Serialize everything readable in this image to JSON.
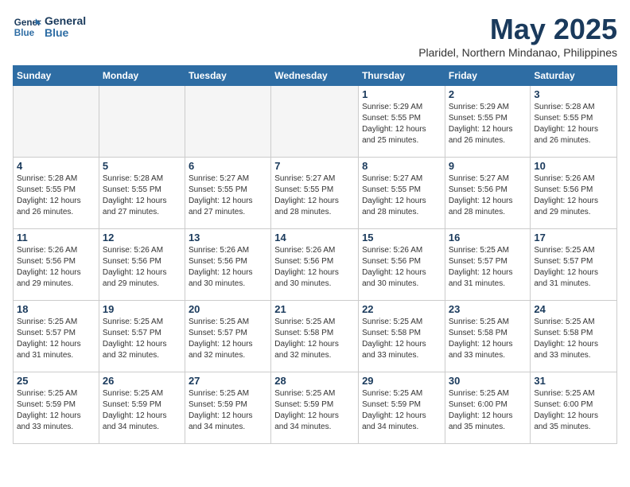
{
  "header": {
    "logo_line1": "General",
    "logo_line2": "Blue",
    "month": "May 2025",
    "location": "Plaridel, Northern Mindanao, Philippines"
  },
  "weekdays": [
    "Sunday",
    "Monday",
    "Tuesday",
    "Wednesday",
    "Thursday",
    "Friday",
    "Saturday"
  ],
  "weeks": [
    [
      {
        "day": "",
        "info": ""
      },
      {
        "day": "",
        "info": ""
      },
      {
        "day": "",
        "info": ""
      },
      {
        "day": "",
        "info": ""
      },
      {
        "day": "1",
        "info": "Sunrise: 5:29 AM\nSunset: 5:55 PM\nDaylight: 12 hours\nand 25 minutes."
      },
      {
        "day": "2",
        "info": "Sunrise: 5:29 AM\nSunset: 5:55 PM\nDaylight: 12 hours\nand 26 minutes."
      },
      {
        "day": "3",
        "info": "Sunrise: 5:28 AM\nSunset: 5:55 PM\nDaylight: 12 hours\nand 26 minutes."
      }
    ],
    [
      {
        "day": "4",
        "info": "Sunrise: 5:28 AM\nSunset: 5:55 PM\nDaylight: 12 hours\nand 26 minutes."
      },
      {
        "day": "5",
        "info": "Sunrise: 5:28 AM\nSunset: 5:55 PM\nDaylight: 12 hours\nand 27 minutes."
      },
      {
        "day": "6",
        "info": "Sunrise: 5:27 AM\nSunset: 5:55 PM\nDaylight: 12 hours\nand 27 minutes."
      },
      {
        "day": "7",
        "info": "Sunrise: 5:27 AM\nSunset: 5:55 PM\nDaylight: 12 hours\nand 28 minutes."
      },
      {
        "day": "8",
        "info": "Sunrise: 5:27 AM\nSunset: 5:55 PM\nDaylight: 12 hours\nand 28 minutes."
      },
      {
        "day": "9",
        "info": "Sunrise: 5:27 AM\nSunset: 5:56 PM\nDaylight: 12 hours\nand 28 minutes."
      },
      {
        "day": "10",
        "info": "Sunrise: 5:26 AM\nSunset: 5:56 PM\nDaylight: 12 hours\nand 29 minutes."
      }
    ],
    [
      {
        "day": "11",
        "info": "Sunrise: 5:26 AM\nSunset: 5:56 PM\nDaylight: 12 hours\nand 29 minutes."
      },
      {
        "day": "12",
        "info": "Sunrise: 5:26 AM\nSunset: 5:56 PM\nDaylight: 12 hours\nand 29 minutes."
      },
      {
        "day": "13",
        "info": "Sunrise: 5:26 AM\nSunset: 5:56 PM\nDaylight: 12 hours\nand 30 minutes."
      },
      {
        "day": "14",
        "info": "Sunrise: 5:26 AM\nSunset: 5:56 PM\nDaylight: 12 hours\nand 30 minutes."
      },
      {
        "day": "15",
        "info": "Sunrise: 5:26 AM\nSunset: 5:56 PM\nDaylight: 12 hours\nand 30 minutes."
      },
      {
        "day": "16",
        "info": "Sunrise: 5:25 AM\nSunset: 5:57 PM\nDaylight: 12 hours\nand 31 minutes."
      },
      {
        "day": "17",
        "info": "Sunrise: 5:25 AM\nSunset: 5:57 PM\nDaylight: 12 hours\nand 31 minutes."
      }
    ],
    [
      {
        "day": "18",
        "info": "Sunrise: 5:25 AM\nSunset: 5:57 PM\nDaylight: 12 hours\nand 31 minutes."
      },
      {
        "day": "19",
        "info": "Sunrise: 5:25 AM\nSunset: 5:57 PM\nDaylight: 12 hours\nand 32 minutes."
      },
      {
        "day": "20",
        "info": "Sunrise: 5:25 AM\nSunset: 5:57 PM\nDaylight: 12 hours\nand 32 minutes."
      },
      {
        "day": "21",
        "info": "Sunrise: 5:25 AM\nSunset: 5:58 PM\nDaylight: 12 hours\nand 32 minutes."
      },
      {
        "day": "22",
        "info": "Sunrise: 5:25 AM\nSunset: 5:58 PM\nDaylight: 12 hours\nand 33 minutes."
      },
      {
        "day": "23",
        "info": "Sunrise: 5:25 AM\nSunset: 5:58 PM\nDaylight: 12 hours\nand 33 minutes."
      },
      {
        "day": "24",
        "info": "Sunrise: 5:25 AM\nSunset: 5:58 PM\nDaylight: 12 hours\nand 33 minutes."
      }
    ],
    [
      {
        "day": "25",
        "info": "Sunrise: 5:25 AM\nSunset: 5:59 PM\nDaylight: 12 hours\nand 33 minutes."
      },
      {
        "day": "26",
        "info": "Sunrise: 5:25 AM\nSunset: 5:59 PM\nDaylight: 12 hours\nand 34 minutes."
      },
      {
        "day": "27",
        "info": "Sunrise: 5:25 AM\nSunset: 5:59 PM\nDaylight: 12 hours\nand 34 minutes."
      },
      {
        "day": "28",
        "info": "Sunrise: 5:25 AM\nSunset: 5:59 PM\nDaylight: 12 hours\nand 34 minutes."
      },
      {
        "day": "29",
        "info": "Sunrise: 5:25 AM\nSunset: 5:59 PM\nDaylight: 12 hours\nand 34 minutes."
      },
      {
        "day": "30",
        "info": "Sunrise: 5:25 AM\nSunset: 6:00 PM\nDaylight: 12 hours\nand 35 minutes."
      },
      {
        "day": "31",
        "info": "Sunrise: 5:25 AM\nSunset: 6:00 PM\nDaylight: 12 hours\nand 35 minutes."
      }
    ]
  ]
}
